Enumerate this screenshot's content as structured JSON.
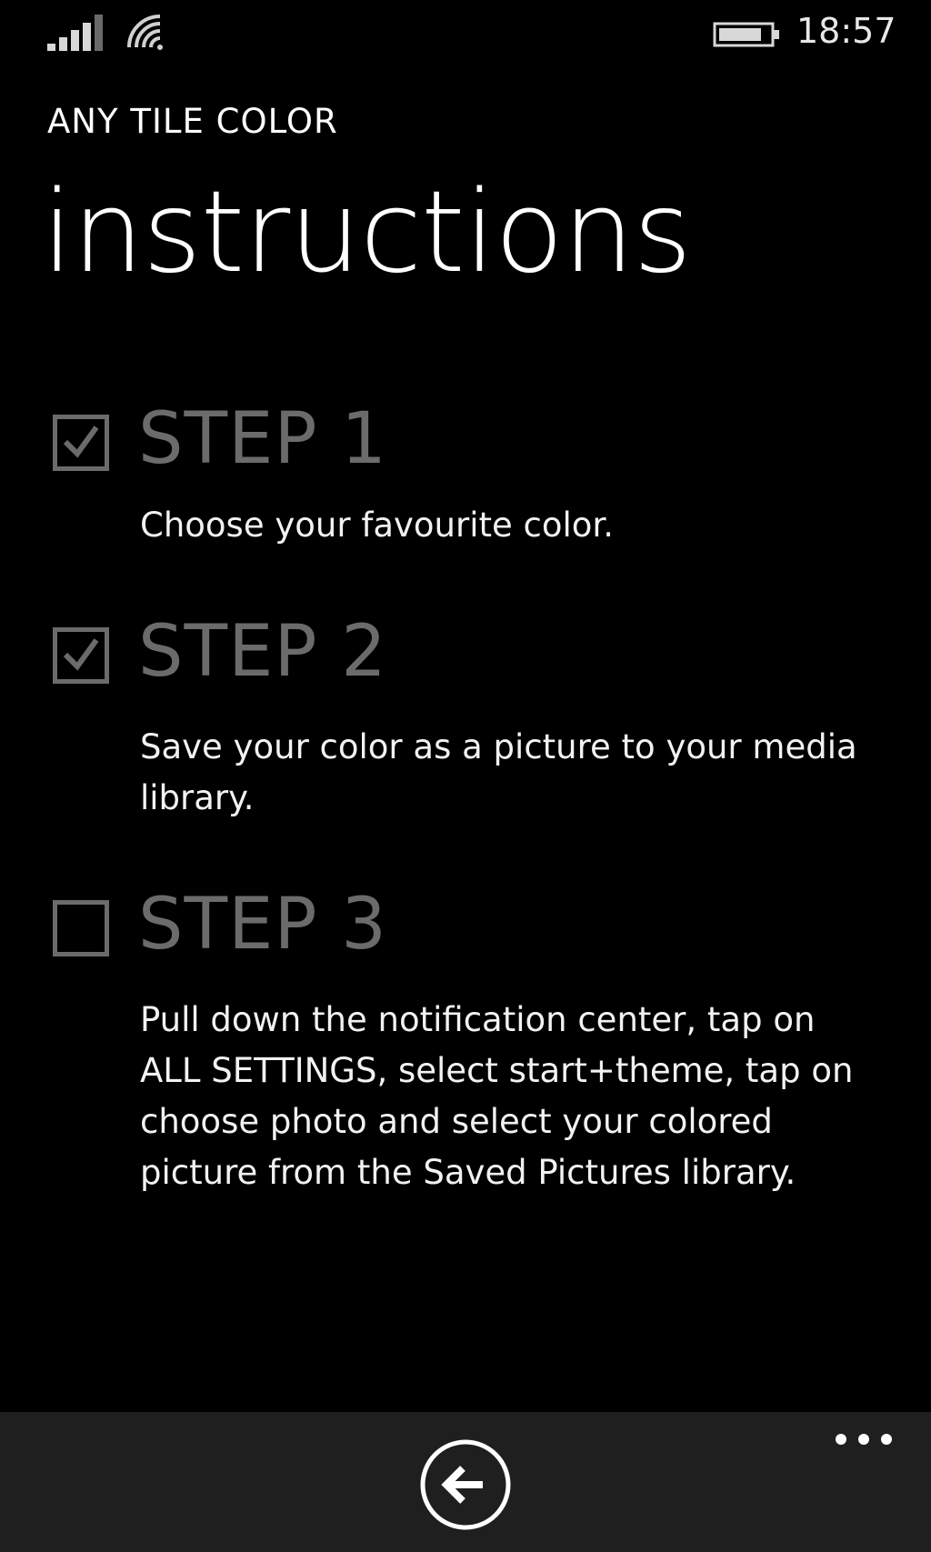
{
  "status_bar": {
    "time": "18:57",
    "icons": [
      "signal-icon",
      "wifi-icon",
      "battery-icon"
    ]
  },
  "header": {
    "app_title": "ANY TILE COLOR",
    "page_title": "instructions"
  },
  "steps": [
    {
      "title": "STEP 1",
      "description": "Choose your favourite color.",
      "checked": true
    },
    {
      "title": "STEP 2",
      "description": "Save your color as a picture to your media library.",
      "checked": true
    },
    {
      "title": "STEP 3",
      "description": "Pull down the notification center, tap on ALL SETTINGS, select start+theme, tap on choose photo and select your colored picture from the Saved Pictures library.",
      "checked": false
    }
  ],
  "app_bar": {
    "buttons": [
      "back-arrow-icon",
      "more-options-icon"
    ]
  },
  "colors": {
    "background": "#000000",
    "app_bar": "#1f1f1f",
    "step_heading": "#6b6b6b",
    "text": "#ffffff"
  }
}
